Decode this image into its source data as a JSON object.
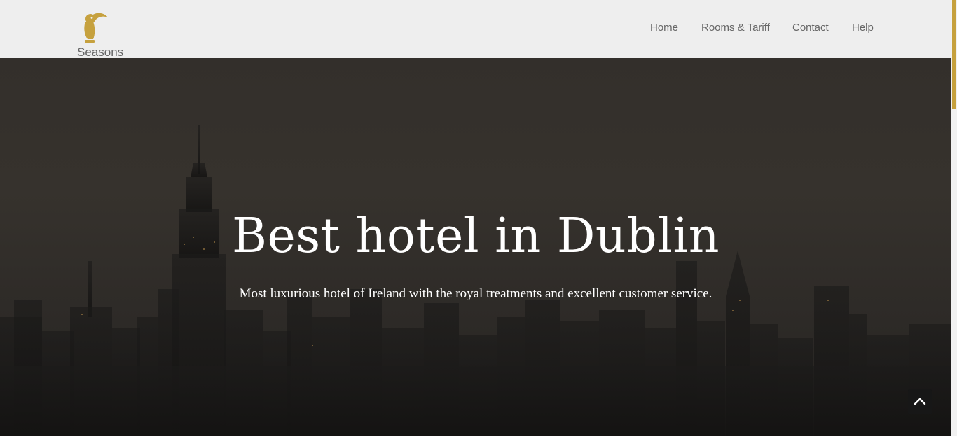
{
  "brand": {
    "name": "Seasons",
    "logo_icon": "toucan-icon",
    "accent_color": "#c6a13e"
  },
  "nav": {
    "items": [
      {
        "label": "Home"
      },
      {
        "label": "Rooms & Tariff"
      },
      {
        "label": "Contact"
      },
      {
        "label": "Help"
      }
    ]
  },
  "hero": {
    "title": "Best hotel in Dublin",
    "subtitle": "Most luxurious hotel of Ireland with the royal treatments and excellent customer service.",
    "background": "city-skyline-night"
  },
  "back_to_top": {
    "icon": "chevron-up-icon"
  }
}
